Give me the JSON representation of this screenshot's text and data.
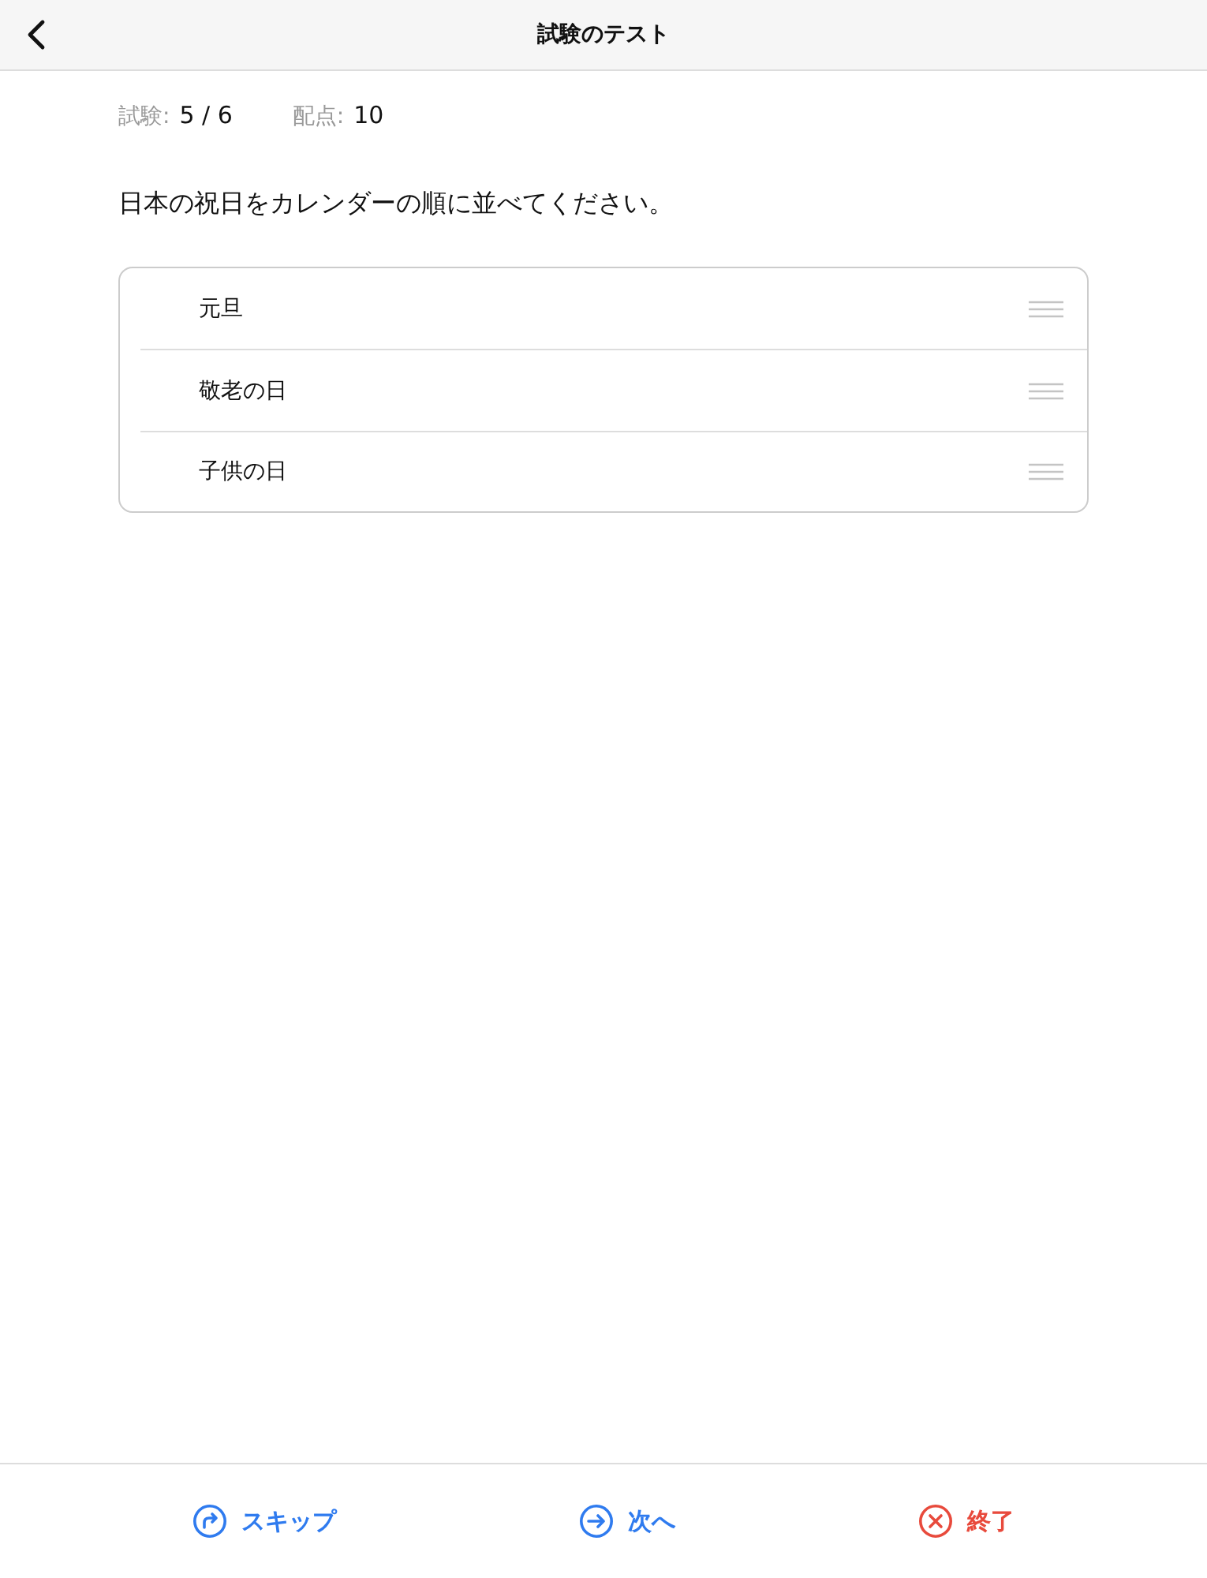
{
  "header": {
    "title": "試験のテスト"
  },
  "meta": [
    {
      "label": "試験:",
      "value": "5 / 6"
    },
    {
      "label": "配点:",
      "value": "10"
    }
  ],
  "question": "日本の祝日をカレンダーの順に並べてください。",
  "items": [
    {
      "label": "元旦"
    },
    {
      "label": "敬老の日"
    },
    {
      "label": "子供の日"
    }
  ],
  "footer": [
    {
      "kind": "skip",
      "label": "スキップ"
    },
    {
      "kind": "next",
      "label": "次へ"
    },
    {
      "kind": "quit",
      "label": "終了"
    }
  ]
}
